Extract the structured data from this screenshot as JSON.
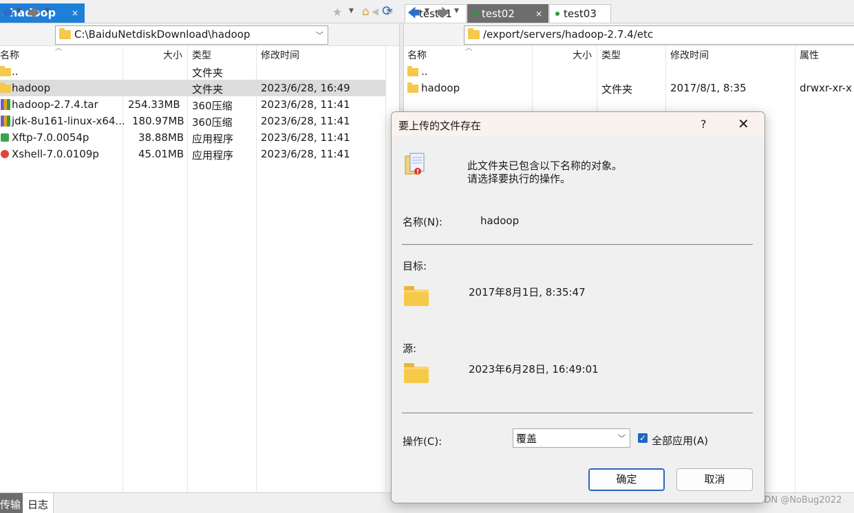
{
  "left_tab": {
    "label": "hadoop",
    "close": "×"
  },
  "nav_arrows": {
    "prev": "◀",
    "next": "▶"
  },
  "right_tabs": [
    {
      "label": "test01"
    },
    {
      "label": "test02",
      "close": "×"
    },
    {
      "label": "test03"
    }
  ],
  "left_pane": {
    "path": "C:\\BaiduNetdiskDownload\\hadoop",
    "columns": {
      "name": "名称",
      "size": "大小",
      "type": "类型",
      "modified": "修改时间"
    },
    "rows": [
      {
        "name": "..",
        "size": "",
        "type": "文件夹",
        "modified": ""
      },
      {
        "name": "hadoop",
        "size": "",
        "type": "文件夹",
        "modified": "2023/6/28, 16:49"
      },
      {
        "name": "hadoop-2.7.4.tar",
        "size": "254.33MB",
        "type": "360压缩",
        "modified": "2023/6/28, 11:41"
      },
      {
        "name": "jdk-8u161-linux-x64...",
        "size": "180.97MB",
        "type": "360压缩",
        "modified": "2023/6/28, 11:41"
      },
      {
        "name": "Xftp-7.0.0054p",
        "size": "38.88MB",
        "type": "应用程序",
        "modified": "2023/6/28, 11:41"
      },
      {
        "name": "Xshell-7.0.0109p",
        "size": "45.01MB",
        "type": "应用程序",
        "modified": "2023/6/28, 11:41"
      }
    ]
  },
  "right_pane": {
    "path": "/export/servers/hadoop-2.7.4/etc",
    "columns": {
      "name": "名称",
      "size": "大小",
      "type": "类型",
      "modified": "修改时间",
      "attr": "属性"
    },
    "rows": [
      {
        "name": "..",
        "size": "",
        "type": "",
        "modified": "",
        "attr": ""
      },
      {
        "name": "hadoop",
        "size": "",
        "type": "文件夹",
        "modified": "2017/8/1, 8:35",
        "attr": "drwxr-xr-x"
      }
    ]
  },
  "bottom_tabs": [
    {
      "label": "传输"
    },
    {
      "label": "日志"
    }
  ],
  "watermark": "CSDN @NoBug2022",
  "dialog": {
    "title": "要上传的文件存在",
    "help": "?",
    "close": "✕",
    "message_line1": "此文件夹已包含以下名称的对象。",
    "message_line2": "请选择要执行的操作。",
    "name_label": "名称(N):",
    "name_value": "hadoop",
    "target_label": "目标:",
    "target_date": "2017年8月1日, 8:35:47",
    "source_label": "源:",
    "source_date": "2023年6月28日, 16:49:01",
    "action_label": "操作(C):",
    "action_value": "覆盖",
    "apply_all_label": "全部应用(A)",
    "apply_all_checked": true,
    "ok_label": "确定",
    "cancel_label": "取消"
  }
}
